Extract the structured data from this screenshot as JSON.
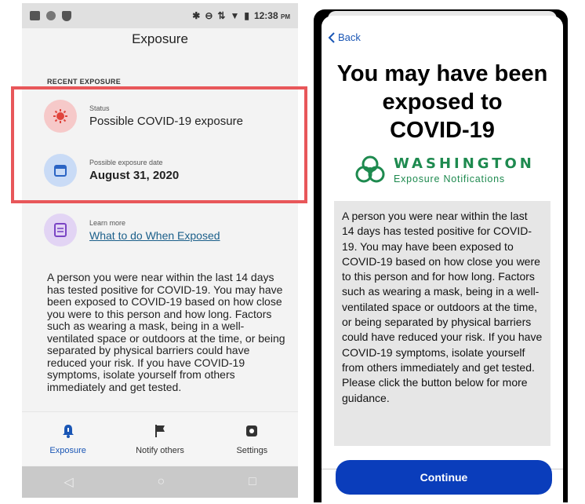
{
  "android": {
    "status_time": "12:38",
    "status_ampm": "PM",
    "title": "Exposure",
    "section_label": "RECENT EXPOSURE",
    "status_row": {
      "label": "Status",
      "value": "Possible COVID-19 exposure"
    },
    "date_row": {
      "label": "Possible exposure date",
      "value": "August 31, 2020"
    },
    "learn_row": {
      "label": "Learn more",
      "link": "What to do When Exposed"
    },
    "body": "A person you were near within the last 14 days has tested positive for COVID-19. You may have been exposed to COVID-19 based on how close you were to this person and how long. Factors such as wearing a mask, being in a well-ventilated space or outdoors at the time, or being separated by physical barriers could have reduced your risk. If you have COVID-19 symptoms, isolate yourself from others immediately and get tested.",
    "nav": [
      {
        "label": "Exposure",
        "icon": "bell-icon",
        "active": true
      },
      {
        "label": "Notify others",
        "icon": "flag-icon",
        "active": false
      },
      {
        "label": "Settings",
        "icon": "gear-icon",
        "active": false
      }
    ],
    "colors": {
      "accent": "#1a56b5",
      "highlight": "#e8575a"
    }
  },
  "ios": {
    "back_label": "Back",
    "title": "You may have been exposed to COVID-19",
    "logo_name": "WASHINGTON",
    "logo_sub": "Exposure Notifications",
    "body": "A person you were near within the last 14 days has tested positive for COVID-19. You may have been exposed to COVID-19 based on how close you were to this person and for how long. Factors such as wearing a mask, being in a well-ventilated space or outdoors at the time, or being separated by physical barriers could have reduced your risk. If you have COVID-19 symptoms, isolate yourself from others immediately and get tested. Please click the button below for more guidance.",
    "continue_label": "Continue",
    "colors": {
      "brand_green": "#1e8a4f",
      "button": "#0a3dbb"
    }
  }
}
